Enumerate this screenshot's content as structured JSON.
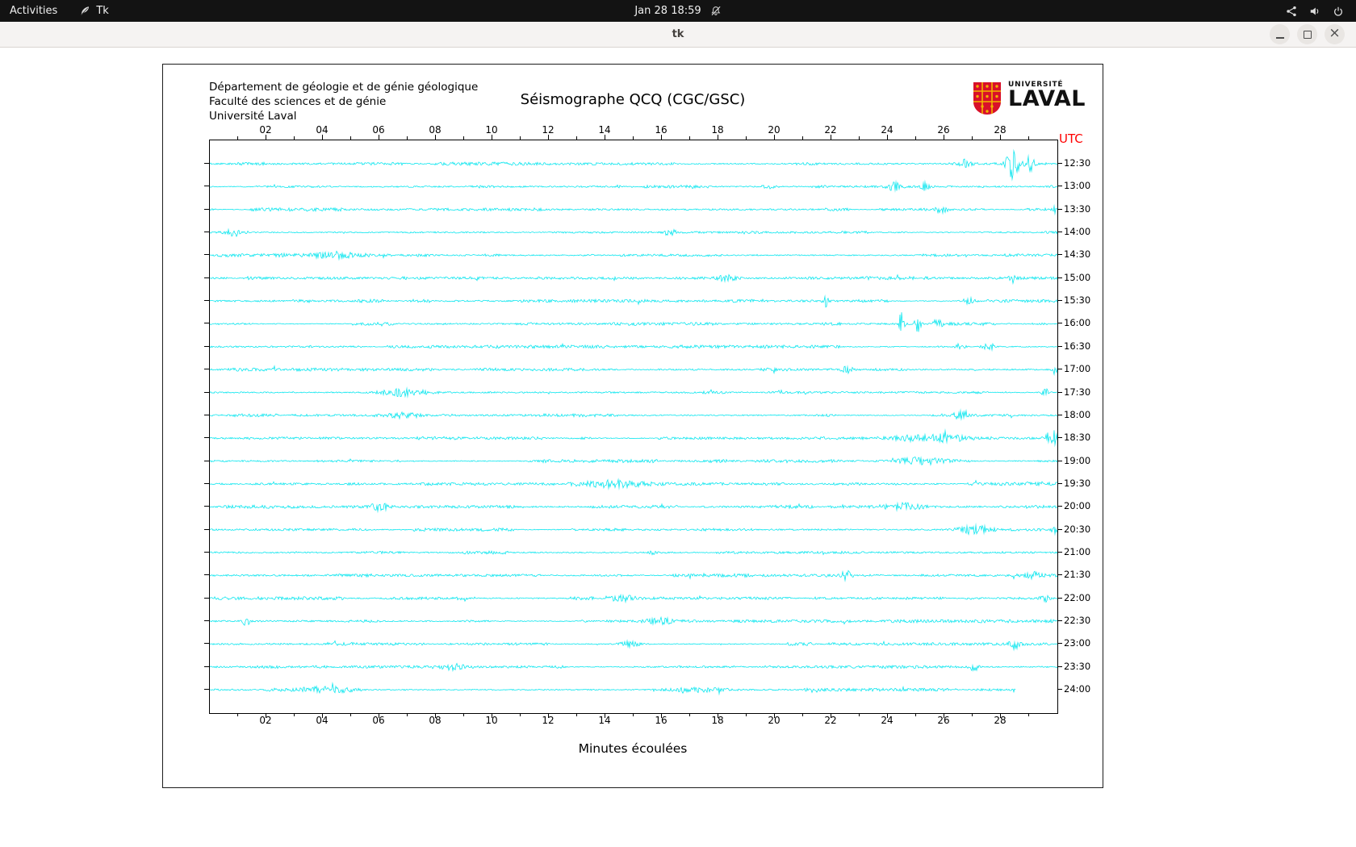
{
  "topbar": {
    "activities_label": "Activities",
    "app_name": "Tk",
    "clock": "Jan 28 18:59"
  },
  "window": {
    "title": "tk",
    "close_glyph": "×"
  },
  "seismograph": {
    "institution_lines": [
      "Département de géologie et de génie géologique",
      "Faculté des sciences et de génie",
      "Université Laval"
    ],
    "title": "Séismographe QCQ (CGC/GSC)",
    "logo_top": "UNIVERSITÉ",
    "logo_bottom": "LAVAL",
    "utc_label": "UTC",
    "utc_color": "#ff0000",
    "trace_color": "#00e5ee",
    "x_tick_labels": [
      "02",
      "04",
      "06",
      "08",
      "10",
      "12",
      "14",
      "16",
      "18",
      "20",
      "22",
      "24",
      "26",
      "28"
    ],
    "row_labels": [
      "12:30",
      "13:00",
      "13:30",
      "14:00",
      "14:30",
      "15:00",
      "15:30",
      "16:00",
      "16:30",
      "17:00",
      "17:30",
      "18:00",
      "18:30",
      "19:00",
      "19:30",
      "20:00",
      "20:30",
      "21:00",
      "21:30",
      "22:00",
      "22:30",
      "23:00",
      "23:30",
      "24:00"
    ],
    "x_axis_label": "Minutes écoulées",
    "minutes_span": 30,
    "last_trace_end_minute": 28.5
  }
}
